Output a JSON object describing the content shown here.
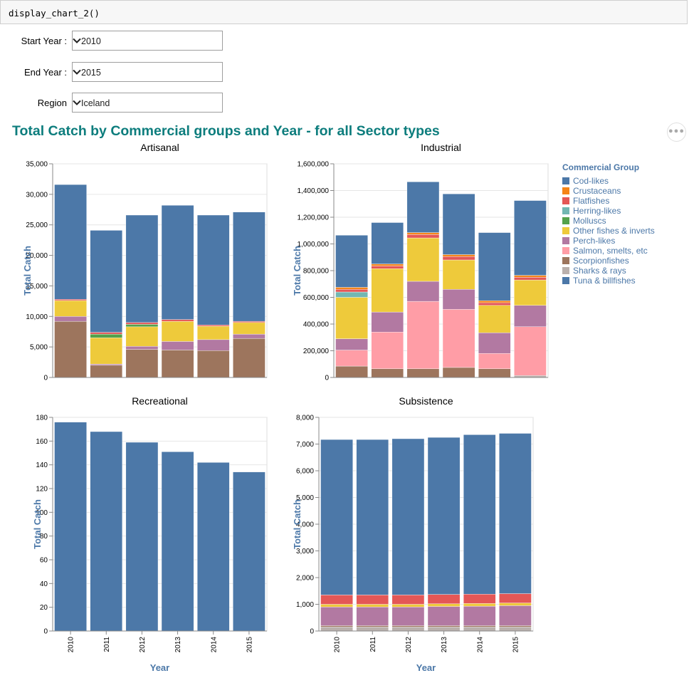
{
  "code_cell": {
    "text": "display_chart_2()"
  },
  "controls": [
    {
      "label": "Start Year :",
      "value": "2010"
    },
    {
      "label": "End Year :",
      "value": "2015"
    },
    {
      "label": "Region",
      "value": "Iceland"
    }
  ],
  "icons": {
    "dropdown": "chevron-down-icon",
    "more": "more-horizontal-icon"
  },
  "chart_data": {
    "title": "Total Catch by Commercial groups and Year - for all Sector types",
    "type": "bar",
    "stacked": true,
    "categories": [
      "2010",
      "2011",
      "2012",
      "2013",
      "2014",
      "2015"
    ],
    "x_label": "Year",
    "y_label": "Total Catch",
    "legend": {
      "title": "Commercial Group",
      "placement": "right",
      "items": [
        {
          "name": "Cod-likes",
          "color": "#4c78a8"
        },
        {
          "name": "Crustaceans",
          "color": "#f58518"
        },
        {
          "name": "Flatfishes",
          "color": "#e45756"
        },
        {
          "name": "Herring-likes",
          "color": "#72b7b2"
        },
        {
          "name": "Molluscs",
          "color": "#54a24b"
        },
        {
          "name": "Other fishes & inverts",
          "color": "#eeca3b"
        },
        {
          "name": "Perch-likes",
          "color": "#b279a2"
        },
        {
          "name": "Salmon, smelts, etc",
          "color": "#ff9da6"
        },
        {
          "name": "Scorpionfishes",
          "color": "#9d755d"
        },
        {
          "name": "Sharks & rays",
          "color": "#bab0ac"
        },
        {
          "name": "Tuna & billfishes",
          "color": "#4c78a8"
        }
      ]
    },
    "panels": [
      {
        "title": "Artisanal",
        "ylim": [
          0,
          35000
        ],
        "yticks": [
          0,
          5000,
          10000,
          15000,
          20000,
          25000,
          30000,
          35000
        ],
        "tick_labels": [
          "0",
          "5,000",
          "10,000",
          "15,000",
          "20,000",
          "25,000",
          "30,000",
          "35,000"
        ],
        "series": [
          {
            "name": "Scorpionfishes",
            "values": [
              9200,
              2000,
              4600,
              4500,
              4400,
              6400
            ]
          },
          {
            "name": "Perch-likes",
            "values": [
              800,
              200,
              500,
              1400,
              1800,
              700
            ]
          },
          {
            "name": "Other fishes & inverts",
            "values": [
              2600,
              4300,
              3200,
              3300,
              2200,
              1900
            ]
          },
          {
            "name": "Molluscs",
            "values": [
              0,
              600,
              400,
              0,
              0,
              0
            ]
          },
          {
            "name": "Flatfishes",
            "values": [
              200,
              300,
              300,
              300,
              200,
              200
            ]
          },
          {
            "name": "Cod-likes",
            "values": [
              18800,
              16700,
              17600,
              18700,
              18000,
              17900
            ]
          }
        ]
      },
      {
        "title": "Industrial",
        "ylim": [
          0,
          1600000
        ],
        "yticks": [
          0,
          200000,
          400000,
          600000,
          800000,
          1000000,
          1200000,
          1400000,
          1600000
        ],
        "tick_labels": [
          "0",
          "200,000",
          "400,000",
          "600,000",
          "800,000",
          "1,000,000",
          "1,200,000",
          "1,400,000",
          "1,600,000"
        ],
        "series": [
          {
            "name": "Sharks & rays",
            "values": [
              0,
              0,
              0,
              0,
              0,
              15000
            ]
          },
          {
            "name": "Scorpionfishes",
            "values": [
              85000,
              65000,
              65000,
              75000,
              65000,
              0
            ]
          },
          {
            "name": "Salmon, smelts, etc",
            "values": [
              120000,
              275000,
              505000,
              435000,
              115000,
              365000
            ]
          },
          {
            "name": "Perch-likes",
            "values": [
              85000,
              150000,
              150000,
              150000,
              155000,
              160000
            ]
          },
          {
            "name": "Other fishes & inverts",
            "values": [
              310000,
              325000,
              325000,
              220000,
              205000,
              190000
            ]
          },
          {
            "name": "Herring-likes",
            "values": [
              40000,
              0,
              0,
              0,
              0,
              0
            ]
          },
          {
            "name": "Flatfishes",
            "values": [
              20000,
              20000,
              25000,
              25000,
              20000,
              20000
            ]
          },
          {
            "name": "Crustaceans",
            "values": [
              15000,
              15000,
              15000,
              15000,
              15000,
              15000
            ]
          },
          {
            "name": "Cod-likes",
            "values": [
              390000,
              310000,
              380000,
              455000,
              510000,
              560000
            ]
          }
        ]
      },
      {
        "title": "Recreational",
        "ylim": [
          0,
          180
        ],
        "yticks": [
          0,
          20,
          40,
          60,
          80,
          100,
          120,
          140,
          160,
          180
        ],
        "tick_labels": [
          "0",
          "20",
          "40",
          "60",
          "80",
          "100",
          "120",
          "140",
          "160",
          "180"
        ],
        "series": [
          {
            "name": "Cod-likes",
            "values": [
              176,
              168,
              159,
              151,
              142,
              134
            ]
          }
        ]
      },
      {
        "title": "Subsistence",
        "ylim": [
          0,
          8000
        ],
        "yticks": [
          0,
          1000,
          2000,
          3000,
          4000,
          5000,
          6000,
          7000,
          8000
        ],
        "tick_labels": [
          "0",
          "1,000",
          "2,000",
          "3,000",
          "4,000",
          "5,000",
          "6,000",
          "7,000",
          "8,000"
        ],
        "series": [
          {
            "name": "Sharks & rays",
            "values": [
              150,
              150,
              150,
              150,
              150,
              150
            ]
          },
          {
            "name": "Scorpionfishes",
            "values": [
              50,
              50,
              50,
              50,
              50,
              50
            ]
          },
          {
            "name": "Perch-likes",
            "values": [
              700,
              700,
              700,
              720,
              730,
              750
            ]
          },
          {
            "name": "Other fishes & inverts",
            "values": [
              100,
              100,
              100,
              100,
              100,
              100
            ]
          },
          {
            "name": "Flatfishes",
            "values": [
              350,
              350,
              350,
              350,
              350,
              350
            ]
          },
          {
            "name": "Cod-likes",
            "values": [
              5820,
              5820,
              5850,
              5880,
              5970,
              6000
            ]
          }
        ]
      }
    ]
  }
}
